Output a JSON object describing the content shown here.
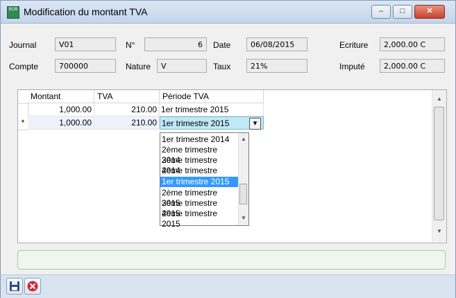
{
  "window": {
    "title": "Modification du montant TVA",
    "app_icon_text": "BOB",
    "minimize_glyph": "–",
    "maximize_glyph": "□",
    "close_glyph": "✕"
  },
  "form": {
    "journal_label": "Journal",
    "journal_value": "V01",
    "numero_label": "N°",
    "numero_value": "6",
    "date_label": "Date",
    "date_value": "06/08/2015",
    "ecriture_label": "Ecriture",
    "ecriture_value": "2,000.00 C",
    "compte_label": "Compte",
    "compte_value": "700000",
    "nature_label": "Nature",
    "nature_value": "V",
    "taux_label": "Taux",
    "taux_value": "21%",
    "impute_label": "Imputé",
    "impute_value": "2,000.00 C"
  },
  "grid": {
    "columns": [
      "Montant",
      "TVA",
      "Période TVA"
    ],
    "rows": [
      {
        "indicator": "",
        "montant": "1,000.00",
        "tva": "210.00",
        "periode": "1er trimestre 2015"
      },
      {
        "indicator": "*",
        "montant": "1,000.00",
        "tva": "210.00",
        "periode": "1er trimestre 2015"
      }
    ],
    "dropdown_button_glyph": "▾",
    "dropdown_options": [
      "1er trimestre 2014",
      "2ème trimestre 2014",
      "3ème trimestre 2014",
      "4ème trimestre 2014",
      "1er trimestre 2015",
      "2ème trimestre 2015",
      "3ème trimestre 2015",
      "4ème trimestre 2015"
    ],
    "selected_option": "1er trimestre 2015"
  },
  "colors": {
    "title_bar": "#c4d5ea",
    "selection": "#3399ff",
    "status_border": "#a9c9a6",
    "close_button": "#c7432f"
  },
  "toolbar": {
    "save_icon": "save-icon",
    "cancel_icon": "cancel-icon"
  }
}
